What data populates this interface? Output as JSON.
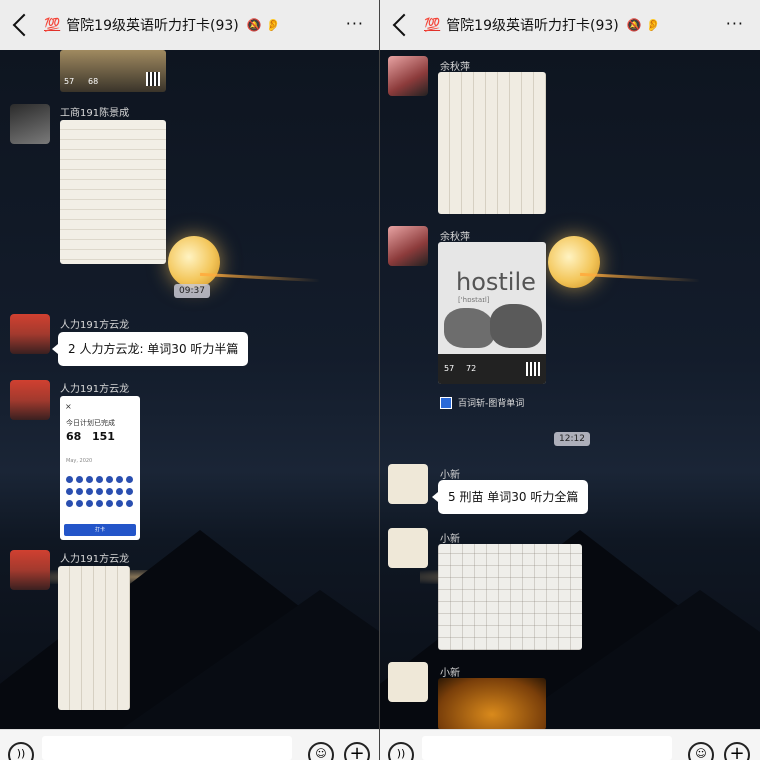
{
  "left": {
    "topbar": {
      "badge": "💯",
      "title": "管院19级英语听力打卡(93)",
      "mute_icon": "bell-off-icon",
      "ear_icon": "ear-icon",
      "more": "···"
    },
    "card_top": {
      "n1": "57",
      "n2": "68"
    },
    "messages": [
      {
        "sender": "工商191陈景成",
        "type": "image"
      },
      {
        "time": "09:37"
      },
      {
        "sender": "人力191方云龙",
        "type": "text",
        "text": "2 人力方云龙: 单词30 听力半篇"
      },
      {
        "sender": "人力191方云龙",
        "type": "app_image",
        "app": {
          "close": "×",
          "header": "今日计划已完成",
          "n1": "68",
          "n2": "151",
          "date": "May, 2020",
          "button": "打卡"
        }
      },
      {
        "sender": "人力191方云龙",
        "type": "image"
      }
    ]
  },
  "right": {
    "topbar": {
      "badge": "💯",
      "title": "管院19级英语听力打卡(93)",
      "mute_icon": "bell-off-icon",
      "ear_icon": "ear-icon",
      "more": "···"
    },
    "messages": [
      {
        "sender": "余秋萍",
        "type": "image"
      },
      {
        "sender": "余秋萍",
        "type": "word_card",
        "card": {
          "word": "hostile",
          "sub": "['hɒstaɪl]",
          "n1": "57",
          "n2": "72"
        }
      },
      {
        "link": "百词斩-图背单词"
      },
      {
        "time": "12:12"
      },
      {
        "sender": "小新",
        "type": "text",
        "text": "5 刑苗 单词30 听力全篇"
      },
      {
        "sender": "小新",
        "type": "image"
      },
      {
        "sender": "小新",
        "type": "image"
      }
    ]
  },
  "bottombar": {
    "voice_icon": "voice-icon",
    "emoji_icon": "emoji-icon",
    "plus_icon": "plus-icon"
  }
}
